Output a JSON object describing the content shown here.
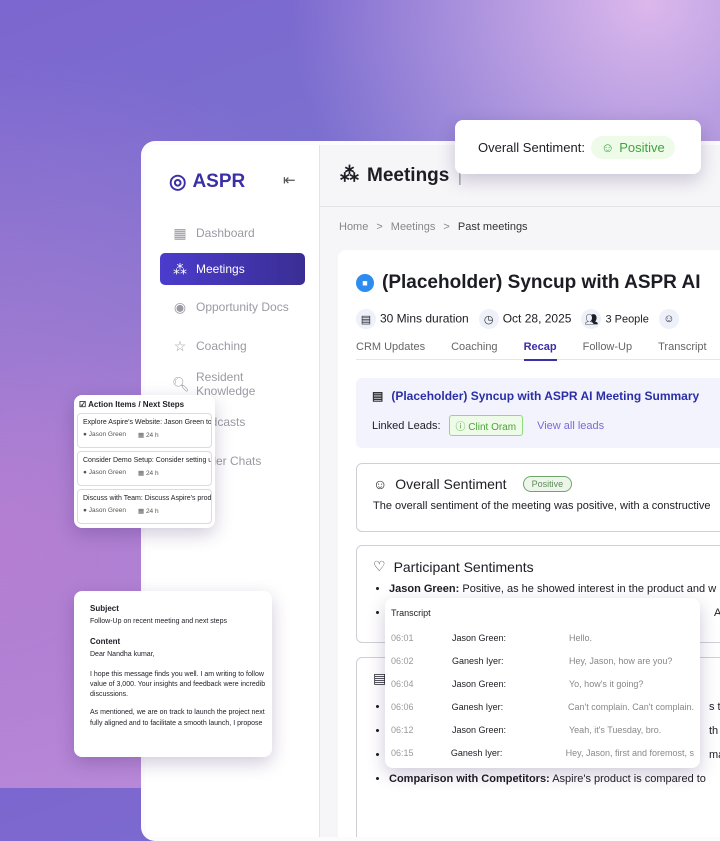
{
  "app": {
    "logo": "ASPR",
    "header_title": "Meetings",
    "header_sep": "|"
  },
  "sidebar": {
    "items": [
      {
        "label": "Dashboard",
        "icon": "dashboard-icon"
      },
      {
        "label": "Meetings",
        "icon": "meetings-icon"
      },
      {
        "label": "Opportunity Docs",
        "icon": "podcast-icon"
      },
      {
        "label": "Coaching",
        "icon": "star-icon"
      },
      {
        "label": "Resident Knowledge",
        "icon": "doc-search-icon"
      },
      {
        "label": "Podcasts",
        "icon": "podcast-icon"
      },
      {
        "label": "Seller Chats",
        "icon": "chat-icon"
      }
    ]
  },
  "breadcrumb": [
    "Home",
    "Meetings",
    "Past meetings"
  ],
  "meeting": {
    "title": "(Placeholder) Syncup with ASPR AI",
    "duration": "30 Mins duration",
    "date": "Oct 28, 2025",
    "people": "3 People",
    "tabs": [
      "CRM Updates",
      "Coaching",
      "Recap",
      "Follow-Up",
      "Transcript"
    ],
    "active_tab": "Recap",
    "summary_title": "(Placeholder) Syncup with ASPR AI Meeting Summary",
    "linked_leads_label": "Linked Leads:",
    "lead": "Clint Oram",
    "view_all": "View all leads",
    "overall_title": "Overall Sentiment",
    "overall_badge": "Positive",
    "overall_text": "The overall sentiment of the meeting was positive, with a constructive",
    "participant_title": "Participant Sentiments",
    "participant_name": "Jason Green:",
    "participant_text": "Positive, as he showed interest in the product and w",
    "participant2_tail": "As",
    "next_items_tail": [
      "s t",
      "th",
      "ma"
    ],
    "comparison_label": "Comparison with Competitors:",
    "comparison_text": "Aspire's product is compared to"
  },
  "sentiment_popup": {
    "label": "Overall Sentiment:",
    "value": "Positive"
  },
  "action_items": {
    "title": "Action Items / Next Steps",
    "items": [
      {
        "text": "Explore Aspire's Website: Jason Green to e",
        "owner": "Jason Green",
        "due": "24 h"
      },
      {
        "text": "Consider Demo Setup: Consider setting up",
        "owner": "Jason Green",
        "due": "24 h"
      },
      {
        "text": "Discuss with Team: Discuss Aspire's produ",
        "owner": "Jason Green",
        "due": "24 h"
      }
    ]
  },
  "email": {
    "subject_label": "Subject",
    "subject": "Follow-Up on recent meeting and next steps",
    "content_label": "Content",
    "greeting": "Dear Nandha kumar,",
    "p1": [
      "I hope this message finds you well. I am writing to follow",
      "value of 3,000. Your insights and feedback were incredib",
      "discussions."
    ],
    "p2": [
      "As mentioned, we are on track to launch the project next",
      "fully aligned and to facilitate a smooth launch, I propose"
    ]
  },
  "transcript": {
    "title": "Transcript",
    "rows": [
      {
        "time": "06:01",
        "speaker": "Jason Green:",
        "text": "Hello."
      },
      {
        "time": "06:02",
        "speaker": "Ganesh Iyer:",
        "text": "Hey, Jason, how are you?"
      },
      {
        "time": "06:04",
        "speaker": "Jason Green:",
        "text": "Yo, how's it going?"
      },
      {
        "time": "06:06",
        "speaker": "Ganesh Iyer:",
        "text": "Can't complain. Can't complain."
      },
      {
        "time": "06:12",
        "speaker": "Jason Green:",
        "text": "Yeah, it's Tuesday, bro."
      },
      {
        "time": "06:15",
        "speaker": "Ganesh Iyer:",
        "text": "Hey, Jason, first and foremost, s"
      }
    ]
  }
}
